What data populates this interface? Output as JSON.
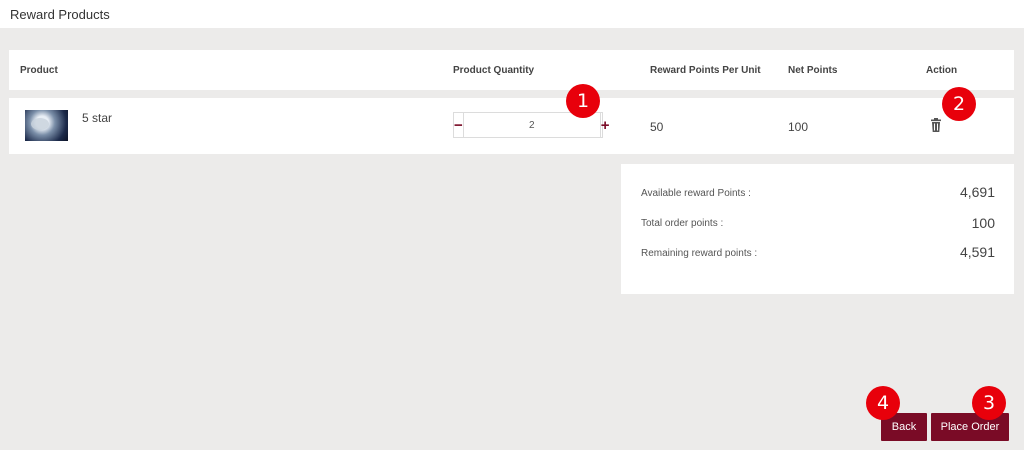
{
  "page": {
    "title": "Reward Products"
  },
  "table": {
    "headers": {
      "product": "Product",
      "quantity": "Product Quantity",
      "points_per_unit": "Reward Points Per Unit",
      "net_points": "Net Points",
      "action": "Action"
    },
    "rows": [
      {
        "product_name": "5 star",
        "quantity": "2",
        "points_per_unit": "50",
        "net_points": "100",
        "minus_symbol": "−",
        "plus_symbol": "+"
      }
    ]
  },
  "summary": {
    "available_label": "Available reward Points :",
    "available_value": "4,691",
    "total_label": "Total order points :",
    "total_value": "100",
    "remaining_label": "Remaining reward points :",
    "remaining_value": "4,591"
  },
  "buttons": {
    "back": "Back",
    "place_order": "Place Order"
  },
  "badges": [
    "1",
    "2",
    "3",
    "4"
  ],
  "colors": {
    "accent": "#7a0b26",
    "badge": "#e8000b",
    "background": "#ecebea"
  },
  "icons": {
    "product_image": "product-thumbnail",
    "delete": "trash-icon"
  }
}
